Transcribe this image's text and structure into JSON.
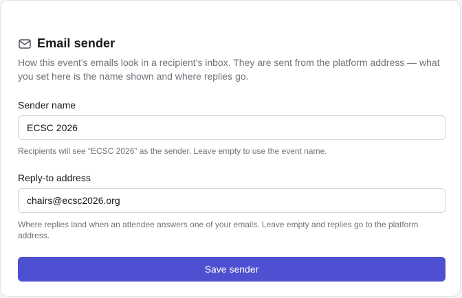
{
  "section": {
    "icon": "mail-icon",
    "title": "Email sender",
    "description": "How this event's emails look in a recipient's inbox. They are sent from the platform address — what you set here is the name shown and where replies go."
  },
  "sender_name": {
    "label": "Sender name",
    "value": "ECSC 2026",
    "help": "Recipients will see “ECSC 2026” as the sender. Leave empty to use the event name."
  },
  "reply_to": {
    "label": "Reply-to address",
    "value": "chairs@ecsc2026.org",
    "help": "Where replies land when an attendee answers one of your emails. Leave empty and replies go to the platform address."
  },
  "actions": {
    "save_label": "Save sender"
  },
  "colors": {
    "accent": "#4f4fd1",
    "text": "#18181b",
    "muted": "#71717a",
    "border": "#d4d4d8"
  }
}
